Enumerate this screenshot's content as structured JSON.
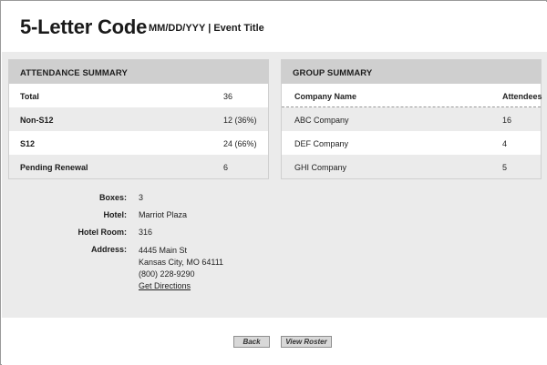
{
  "header": {
    "title": "5-Letter Code",
    "subtitle": "MM/DD/YYY | Event Title"
  },
  "attendance": {
    "heading": "ATTENDANCE SUMMARY",
    "rows": [
      {
        "label": "Total",
        "value": "36"
      },
      {
        "label": "Non-S12",
        "value": "12 (36%)"
      },
      {
        "label": "S12",
        "value": "24 (66%)"
      },
      {
        "label": "Pending Renewal",
        "value": "6"
      }
    ]
  },
  "group": {
    "heading": "GROUP SUMMARY",
    "col_company": "Company Name",
    "col_attendees": "Attendees",
    "rows": [
      {
        "company": "ABC Company",
        "attendees": "16"
      },
      {
        "company": "DEF Company",
        "attendees": "4"
      },
      {
        "company": "GHI Company",
        "attendees": "5"
      }
    ]
  },
  "details": {
    "boxes_label": "Boxes:",
    "boxes_value": "3",
    "hotel_label": "Hotel:",
    "hotel_value": "Marriot Plaza",
    "room_label": "Hotel Room:",
    "room_value": "316",
    "address_label": "Address:",
    "address_line1": "4445 Main St",
    "address_line2": "Kansas City, MO 64111",
    "address_phone": "(800) 228-9290",
    "directions_link": "Get Directions"
  },
  "buttons": {
    "back": "Back",
    "view_roster": "View Roster"
  }
}
